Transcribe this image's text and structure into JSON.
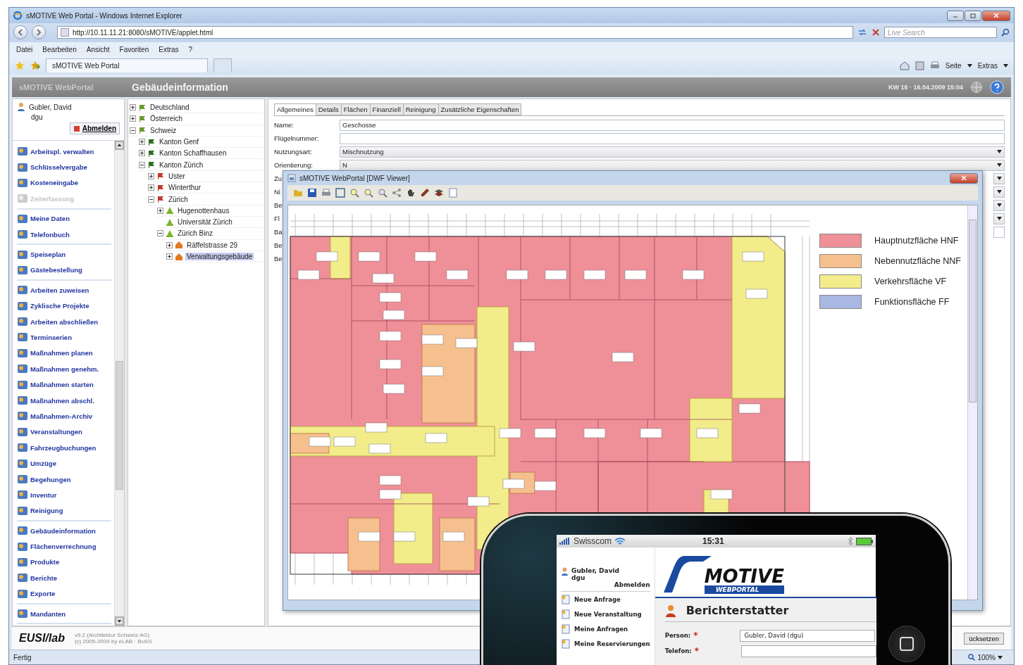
{
  "browser": {
    "title": "sMOTIVE Web Portal - Windows Internet Explorer",
    "address": "http://10.11.11.21:8080/sMOTIVE/applet.html",
    "search": {
      "placeholder": "Live Search"
    },
    "menu": [
      "Datei",
      "Bearbeiten",
      "Ansicht",
      "Favoriten",
      "Extras",
      "?"
    ],
    "tab": "sMOTIVE Web Portal",
    "commands": [
      "Seite",
      "Extras"
    ],
    "status": "Fertig",
    "zoom": "100%"
  },
  "app": {
    "brand": "sMOTIVE WebPortal",
    "title": "Gebäudeinformation",
    "datetime": "KW 16 · 16.04.2009 15:04"
  },
  "user": {
    "name": "Gubler, David",
    "login": "dgu",
    "logout": "Abmelden"
  },
  "sidebar": {
    "groups": [
      [
        {
          "label": "Arbeitspl. verwalten",
          "disabled": false
        },
        {
          "label": "Schlüsselvergabe",
          "disabled": false
        },
        {
          "label": "Kosteneingabe",
          "disabled": false
        },
        {
          "label": "Zeiterfassung",
          "disabled": true
        }
      ],
      [
        {
          "label": "Meine Daten",
          "disabled": false
        },
        {
          "label": "Telefonbuch",
          "disabled": false
        }
      ],
      [
        {
          "label": "Speiseplan",
          "disabled": false
        },
        {
          "label": "Gästebestellung",
          "disabled": false
        }
      ],
      [
        {
          "label": "Arbeiten zuweisen",
          "disabled": false
        },
        {
          "label": "Zyklische Projekte",
          "disabled": false
        },
        {
          "label": "Arbeiten abschließen",
          "disabled": false
        },
        {
          "label": "Terminserien",
          "disabled": false
        },
        {
          "label": "Maßnahmen planen",
          "disabled": false
        },
        {
          "label": "Maßnahmen genehm.",
          "disabled": false
        },
        {
          "label": "Maßnahmen starten",
          "disabled": false
        },
        {
          "label": "Maßnahmen abschl.",
          "disabled": false
        },
        {
          "label": "Maßnahmen-Archiv",
          "disabled": false
        },
        {
          "label": "Veranstaltungen",
          "disabled": false
        },
        {
          "label": "Fahrzeugbuchungen",
          "disabled": false
        },
        {
          "label": "Umzüge",
          "disabled": false
        },
        {
          "label": "Begehungen",
          "disabled": false
        },
        {
          "label": "Inventur",
          "disabled": false
        },
        {
          "label": "Reinigung",
          "disabled": false
        }
      ],
      [
        {
          "label": "Gebäudeinformation",
          "disabled": false
        },
        {
          "label": "Flächenverrechnung",
          "disabled": false
        },
        {
          "label": "Produkte",
          "disabled": false
        },
        {
          "label": "Berichte",
          "disabled": false
        },
        {
          "label": "Exporte",
          "disabled": false
        }
      ],
      [
        {
          "label": "Mandanten",
          "disabled": false
        }
      ]
    ]
  },
  "tree": [
    {
      "label": "Deutschland",
      "kind": "country",
      "expanded": false,
      "selected": false
    },
    {
      "label": "Österreich",
      "kind": "country",
      "expanded": false,
      "selected": false
    },
    {
      "label": "Schweiz",
      "kind": "country",
      "expanded": true,
      "selected": false,
      "children": [
        {
          "label": "Kanton Genf",
          "kind": "canton",
          "expanded": false,
          "selected": false
        },
        {
          "label": "Kanton Schaffhausen",
          "kind": "canton",
          "expanded": false,
          "selected": false
        },
        {
          "label": "Kanton Zürich",
          "kind": "canton",
          "expanded": true,
          "selected": false,
          "children": [
            {
              "label": "Uster",
              "kind": "city",
              "expanded": false,
              "selected": false
            },
            {
              "label": "Winterthur",
              "kind": "city",
              "expanded": false,
              "selected": false
            },
            {
              "label": "Zürich",
              "kind": "city",
              "expanded": true,
              "selected": false,
              "children": [
                {
                  "label": "Hugenottenhaus",
                  "kind": "site",
                  "expanded": false,
                  "selected": false
                },
                {
                  "label": "Universität Zürich",
                  "kind": "site",
                  "selected": false
                },
                {
                  "label": "Zürich Binz",
                  "kind": "site",
                  "expanded": true,
                  "selected": false,
                  "children": [
                    {
                      "label": "Räffelstrasse 29",
                      "kind": "building",
                      "expanded": false,
                      "selected": false
                    },
                    {
                      "label": "Verwaltungsgebäude",
                      "kind": "building",
                      "expanded": false,
                      "selected": true
                    }
                  ]
                }
              ]
            }
          ]
        }
      ]
    }
  ],
  "detail_tabs": [
    {
      "label": "Allgemeines",
      "selected": true
    },
    {
      "label": "Details",
      "selected": false
    },
    {
      "label": "Flächen",
      "selected": false
    },
    {
      "label": "Finanziell",
      "selected": false
    },
    {
      "label": "Reinigung",
      "selected": false
    },
    {
      "label": "Zusätzliche Eigenschaften",
      "selected": false
    }
  ],
  "form": [
    {
      "label": "Name:",
      "kind": "text",
      "value": "Geschosse"
    },
    {
      "label": "Flügelnummer:",
      "kind": "text"
    },
    {
      "label": "Nutzungsart:",
      "kind": "select",
      "value": "Mischnutzung"
    },
    {
      "label": "Orientierung:",
      "kind": "select",
      "value": "N"
    },
    {
      "label": "Zu",
      "kind": "covered_select"
    },
    {
      "label": "Ni",
      "kind": "covered_select"
    },
    {
      "label": "Be",
      "kind": "covered_select"
    },
    {
      "label": "Fl",
      "kind": "covered_select"
    },
    {
      "label": "Ba",
      "kind": "covered_text"
    },
    {
      "label": "Be",
      "kind": "covered"
    },
    {
      "label": "Be",
      "kind": "covered"
    }
  ],
  "viewer": {
    "title": "sMOTIVE WebPortal [DWF Viewer]",
    "legend": [
      {
        "label": "Hauptnutzfläche HNF",
        "color": "#ef8f98"
      },
      {
        "label": "Nebennutzfläche NNF",
        "color": "#f6c08e"
      },
      {
        "label": "Verkehrsfläche VF",
        "color": "#f2ec8a"
      },
      {
        "label": "Funktionsfläche FF",
        "color": "#a9b7e3"
      }
    ]
  },
  "footer": {
    "logo": "EUSI/lab",
    "version": "v9.2 (Architektur Schweiz AG)",
    "copyright": "(c) 2005-2009 by eLAB · BuSS",
    "reset_button": "ücksetzen"
  },
  "phone": {
    "carrier": "Swisscom",
    "time": "15:31",
    "user": {
      "name": "Gubler, David",
      "login": "dgu",
      "logout": "Abmelden"
    },
    "menu": [
      "Neue Anfrage",
      "Neue Veranstaltung",
      "Meine Anfragen",
      "Meine Reservierungen"
    ],
    "logo": {
      "word": "MOTIVE",
      "tagline": "WEBPORTAL"
    },
    "heading": "Berichterstatter",
    "fields": [
      {
        "label": "Person:",
        "required_mark": "*",
        "value": "Gubler, David (dgu)"
      },
      {
        "label": "Telefon:",
        "required_mark": "*"
      }
    ]
  }
}
